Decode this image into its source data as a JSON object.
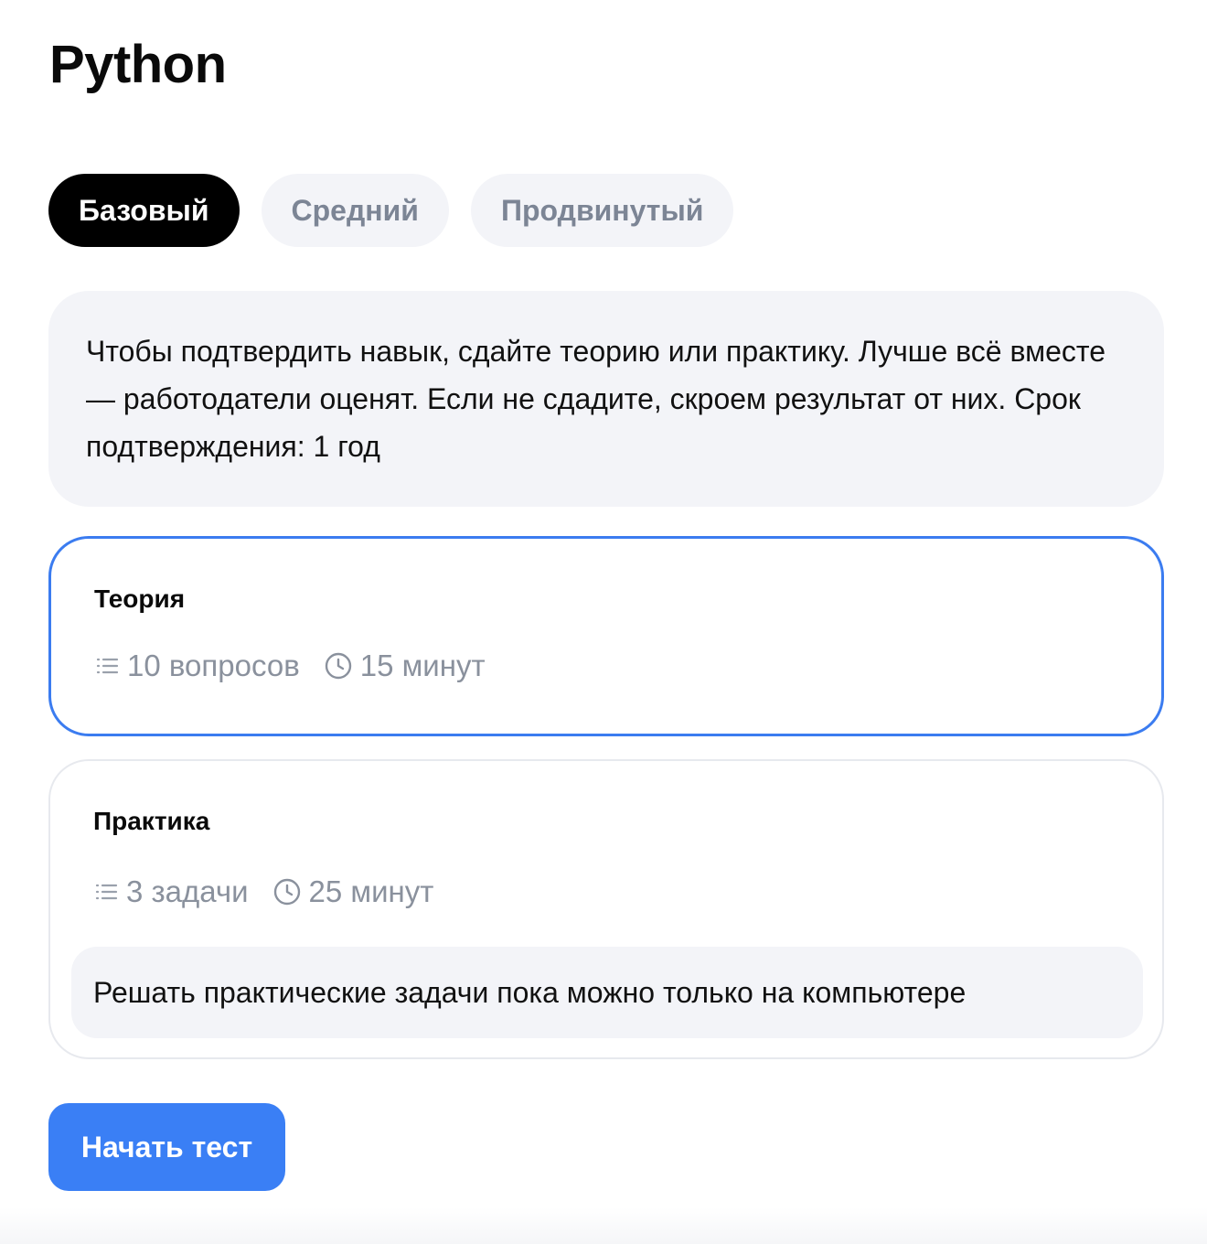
{
  "page": {
    "title": "Python"
  },
  "levels": {
    "tabs": [
      {
        "label": "Базовый",
        "active": true
      },
      {
        "label": "Средний",
        "active": false
      },
      {
        "label": "Продвинутый",
        "active": false
      }
    ]
  },
  "info": {
    "text": "Чтобы подтвердить навык, сдайте теорию или практику. Лучше всё вместе — работодатели оценят. Если не сдадите, скроем результат от них. Срок подтверждения: 1 год"
  },
  "cards": {
    "theory": {
      "title": "Теория",
      "items_label": "10 вопросов",
      "time_label": "15 минут",
      "selected": true
    },
    "practice": {
      "title": "Практика",
      "items_label": "3 задачи",
      "time_label": "25 минут",
      "selected": false,
      "notice": "Решать практические задачи пока можно только на компьютере"
    }
  },
  "actions": {
    "start_label": "Начать тест"
  },
  "icons": {
    "list": "list-icon",
    "clock": "clock-icon"
  },
  "colors": {
    "accent": "#3a7ff5",
    "selected_border": "#3b7cf0",
    "tab_active_bg": "#000000",
    "tab_inactive_bg": "#f3f4f8",
    "muted_text": "#8a919d"
  }
}
